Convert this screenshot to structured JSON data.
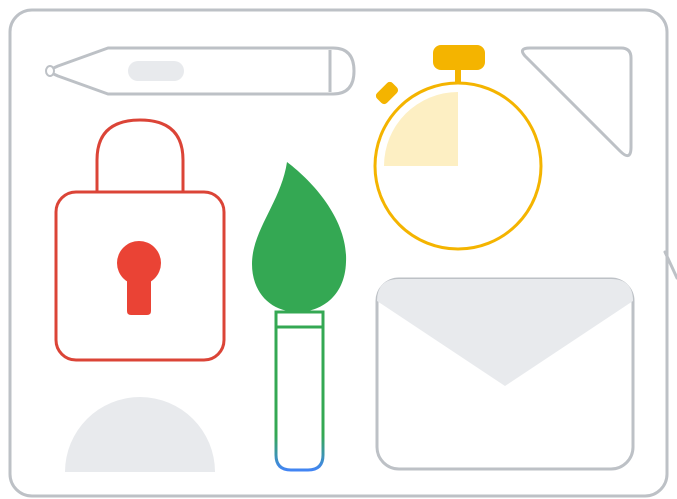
{
  "illustration": {
    "icons": [
      "pencil-icon",
      "stopwatch-icon",
      "set-square-icon",
      "padlock-icon",
      "paintbrush-icon",
      "envelope-icon",
      "protractor-icon"
    ],
    "colors": {
      "outline_gray": "#bdc1c6",
      "fill_light_gray": "#e8eaed",
      "lock_red": "#db4437",
      "stopwatch_yellow": "#f4b400",
      "stopwatch_fill": "#fdefc3",
      "brush_green": "#34a853",
      "brush_blue": "#4285f4",
      "background": "#ffffff"
    },
    "stopwatch": {
      "elapsed_fraction": 0.25
    }
  }
}
